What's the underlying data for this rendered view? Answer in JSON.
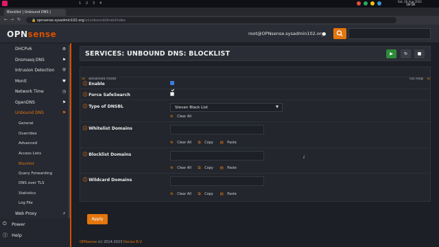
{
  "os": {
    "workspaces": [
      "1",
      "2",
      "3",
      "4"
    ],
    "date": "Sat, 26 Aug 2023",
    "time": "18:58"
  },
  "browser": {
    "tab_title": "Blocklist | Unbound DNS |",
    "url_host": "opnsense.sysadmin102.org",
    "url_path": "/ui/unbound/dnsbl/index"
  },
  "header": {
    "logo_opn": "OPN",
    "logo_sense": "sense",
    "user": "root@OPNsense.sysadmin102.org"
  },
  "sidebar": {
    "items": [
      {
        "label": "DHCPv6",
        "icon": "gear-icon"
      },
      {
        "label": "Dnsmasq DNS",
        "icon": "tags-icon"
      },
      {
        "label": "Intrusion Detection",
        "icon": "shield-icon"
      },
      {
        "label": "Monit",
        "icon": "heartbeat-icon"
      },
      {
        "label": "Network Time",
        "icon": "clock-icon"
      },
      {
        "label": "OpenDNS",
        "icon": "tags-icon"
      },
      {
        "label": "Unbound DNS",
        "icon": "tags-icon"
      }
    ],
    "subitems": [
      "General",
      "Overrides",
      "Advanced",
      "Access Lists",
      "Blocklist",
      "Query Forwarding",
      "DNS over TLS",
      "Statistics",
      "Log File"
    ],
    "active_sub": "Blocklist",
    "webproxy": "Web Proxy",
    "power": "Power",
    "help": "Help"
  },
  "page": {
    "title": "SERVICES: UNBOUND DNS: BLOCKLIST",
    "advanced_mode": "advanced mode",
    "full_help": "full help"
  },
  "form": {
    "enable_label": "Enable",
    "enable_checked": true,
    "safesearch_label": "Force SafeSearch",
    "safesearch_checked": false,
    "dnsbl_label": "Type of DNSBL",
    "dnsbl_value": "Steven Black List",
    "whitelist_label": "Whitelist Domains",
    "blocklist_label": "Blocklist Domains",
    "wildcard_label": "Wildcard Domains",
    "clear_all": "Clear All",
    "copy": "Copy",
    "paste": "Paste",
    "apply": "Apply"
  },
  "footer": {
    "brand": "OPNsense",
    "text": " (c) 2014-2023 ",
    "company": "Deciso B.V."
  }
}
